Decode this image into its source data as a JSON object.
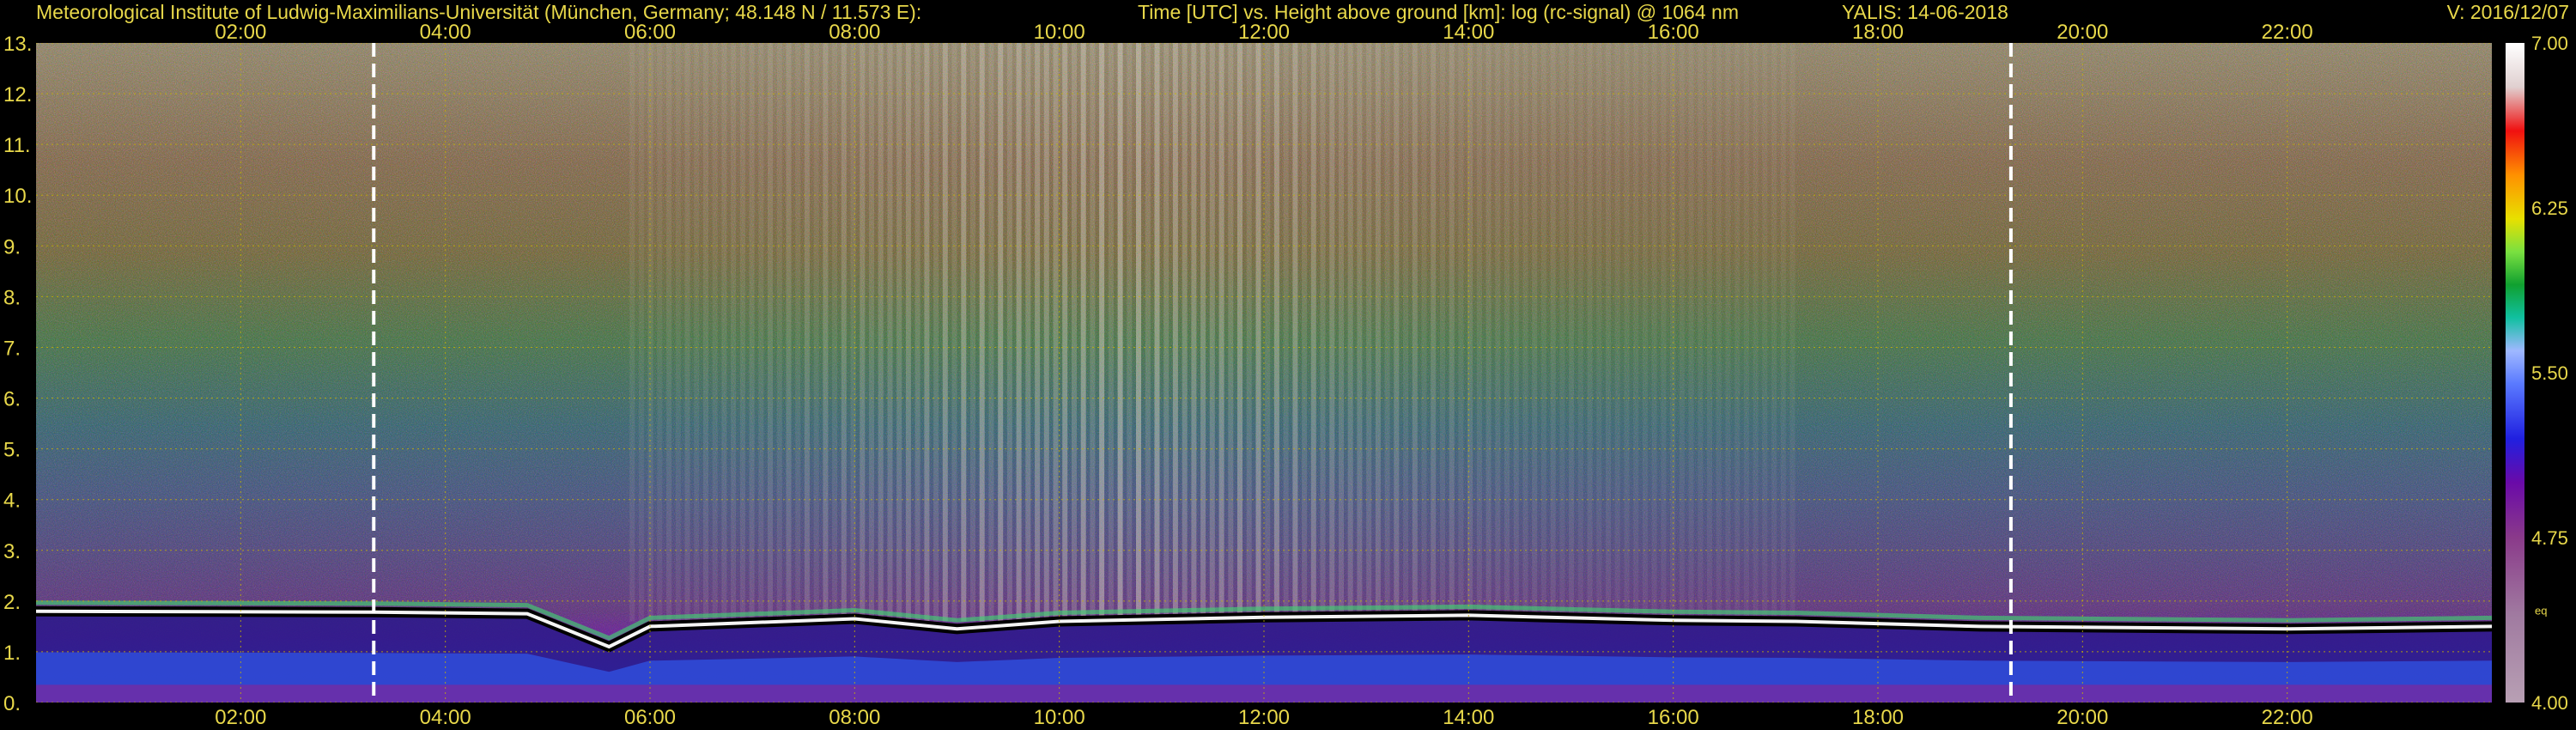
{
  "header": {
    "institute": "Meteorological Institute of Ludwig-Maximilians-Universität (München, Germany; 48.148 N / 11.573 E):",
    "plot_title": "Time [UTC] vs. Height above ground [km]: log (rc-signal) @ 1064 nm",
    "instrument_date": "YALIS: 14-06-2018",
    "version": "V: 2016/12/07"
  },
  "colors": {
    "background": "#000000",
    "text": "#e8d84a",
    "grid": "#c8b400",
    "vertical_marker": "#ffffff"
  },
  "chart_data": {
    "type": "heatmap",
    "title": "Time [UTC] vs. Height above ground [km]: log (rc-signal) @ 1064 nm",
    "xlabel": "Time [UTC]",
    "ylabel": "Height above ground [km]",
    "xlim": [
      0,
      24
    ],
    "ylim": [
      0,
      13
    ],
    "x_ticks": [
      {
        "hour": 2,
        "label": "02:00"
      },
      {
        "hour": 4,
        "label": "04:00"
      },
      {
        "hour": 6,
        "label": "06:00"
      },
      {
        "hour": 8,
        "label": "08:00"
      },
      {
        "hour": 10,
        "label": "10:00"
      },
      {
        "hour": 12,
        "label": "12:00"
      },
      {
        "hour": 14,
        "label": "14:00"
      },
      {
        "hour": 16,
        "label": "16:00"
      },
      {
        "hour": 18,
        "label": "18:00"
      },
      {
        "hour": 20,
        "label": "20:00"
      },
      {
        "hour": 22,
        "label": "22:00"
      }
    ],
    "y_ticks": [
      {
        "value": 0,
        "label": "0."
      },
      {
        "value": 1,
        "label": "1."
      },
      {
        "value": 2,
        "label": "2."
      },
      {
        "value": 3,
        "label": "3."
      },
      {
        "value": 4,
        "label": "4."
      },
      {
        "value": 5,
        "label": "5."
      },
      {
        "value": 6,
        "label": "6."
      },
      {
        "value": 7,
        "label": "7."
      },
      {
        "value": 8,
        "label": "8."
      },
      {
        "value": 9,
        "label": "9."
      },
      {
        "value": 10,
        "label": "10."
      },
      {
        "value": 11,
        "label": "11."
      },
      {
        "value": 12,
        "label": "12."
      },
      {
        "value": 13,
        "label": "13."
      }
    ],
    "vertical_markers_hours": [
      3.3,
      19.3
    ],
    "grid": true,
    "colorbar": {
      "min": 4.0,
      "max": 7.0,
      "ticks": [
        {
          "value": 7.0,
          "label": "7.00"
        },
        {
          "value": 6.25,
          "label": "6.25"
        },
        {
          "value": 5.5,
          "label": "5.50"
        },
        {
          "value": 4.75,
          "label": "4.75"
        },
        {
          "value": 4.0,
          "label": "4.00"
        }
      ],
      "note": "eq",
      "stops": [
        {
          "value": 4.0,
          "color": "#b8a0b4"
        },
        {
          "value": 4.4,
          "color": "#a07aa0"
        },
        {
          "value": 4.75,
          "color": "#8a3a8a"
        },
        {
          "value": 5.0,
          "color": "#6a0aa8"
        },
        {
          "value": 5.2,
          "color": "#2020e0"
        },
        {
          "value": 5.45,
          "color": "#5a7aff"
        },
        {
          "value": 5.6,
          "color": "#9fb8ff"
        },
        {
          "value": 5.75,
          "color": "#10c0a0"
        },
        {
          "value": 5.9,
          "color": "#10a030"
        },
        {
          "value": 6.05,
          "color": "#7ae040"
        },
        {
          "value": 6.2,
          "color": "#e8e000"
        },
        {
          "value": 6.4,
          "color": "#ff9000"
        },
        {
          "value": 6.6,
          "color": "#f01010"
        },
        {
          "value": 6.8,
          "color": "#e0d0d0"
        },
        {
          "value": 7.0,
          "color": "#ffffff"
        }
      ]
    },
    "boundary_layer_top_km": [
      {
        "hour": 0.0,
        "km": 1.8
      },
      {
        "hour": 3.3,
        "km": 1.78
      },
      {
        "hour": 4.8,
        "km": 1.75
      },
      {
        "hour": 5.6,
        "km": 1.1
      },
      {
        "hour": 6.0,
        "km": 1.5
      },
      {
        "hour": 8.0,
        "km": 1.65
      },
      {
        "hour": 9.0,
        "km": 1.45
      },
      {
        "hour": 10.0,
        "km": 1.6
      },
      {
        "hour": 12.0,
        "km": 1.68
      },
      {
        "hour": 14.0,
        "km": 1.72
      },
      {
        "hour": 16.0,
        "km": 1.62
      },
      {
        "hour": 17.2,
        "km": 1.6
      },
      {
        "hour": 19.0,
        "km": 1.5
      },
      {
        "hour": 22.0,
        "km": 1.45
      },
      {
        "hour": 24.0,
        "km": 1.5
      }
    ]
  }
}
